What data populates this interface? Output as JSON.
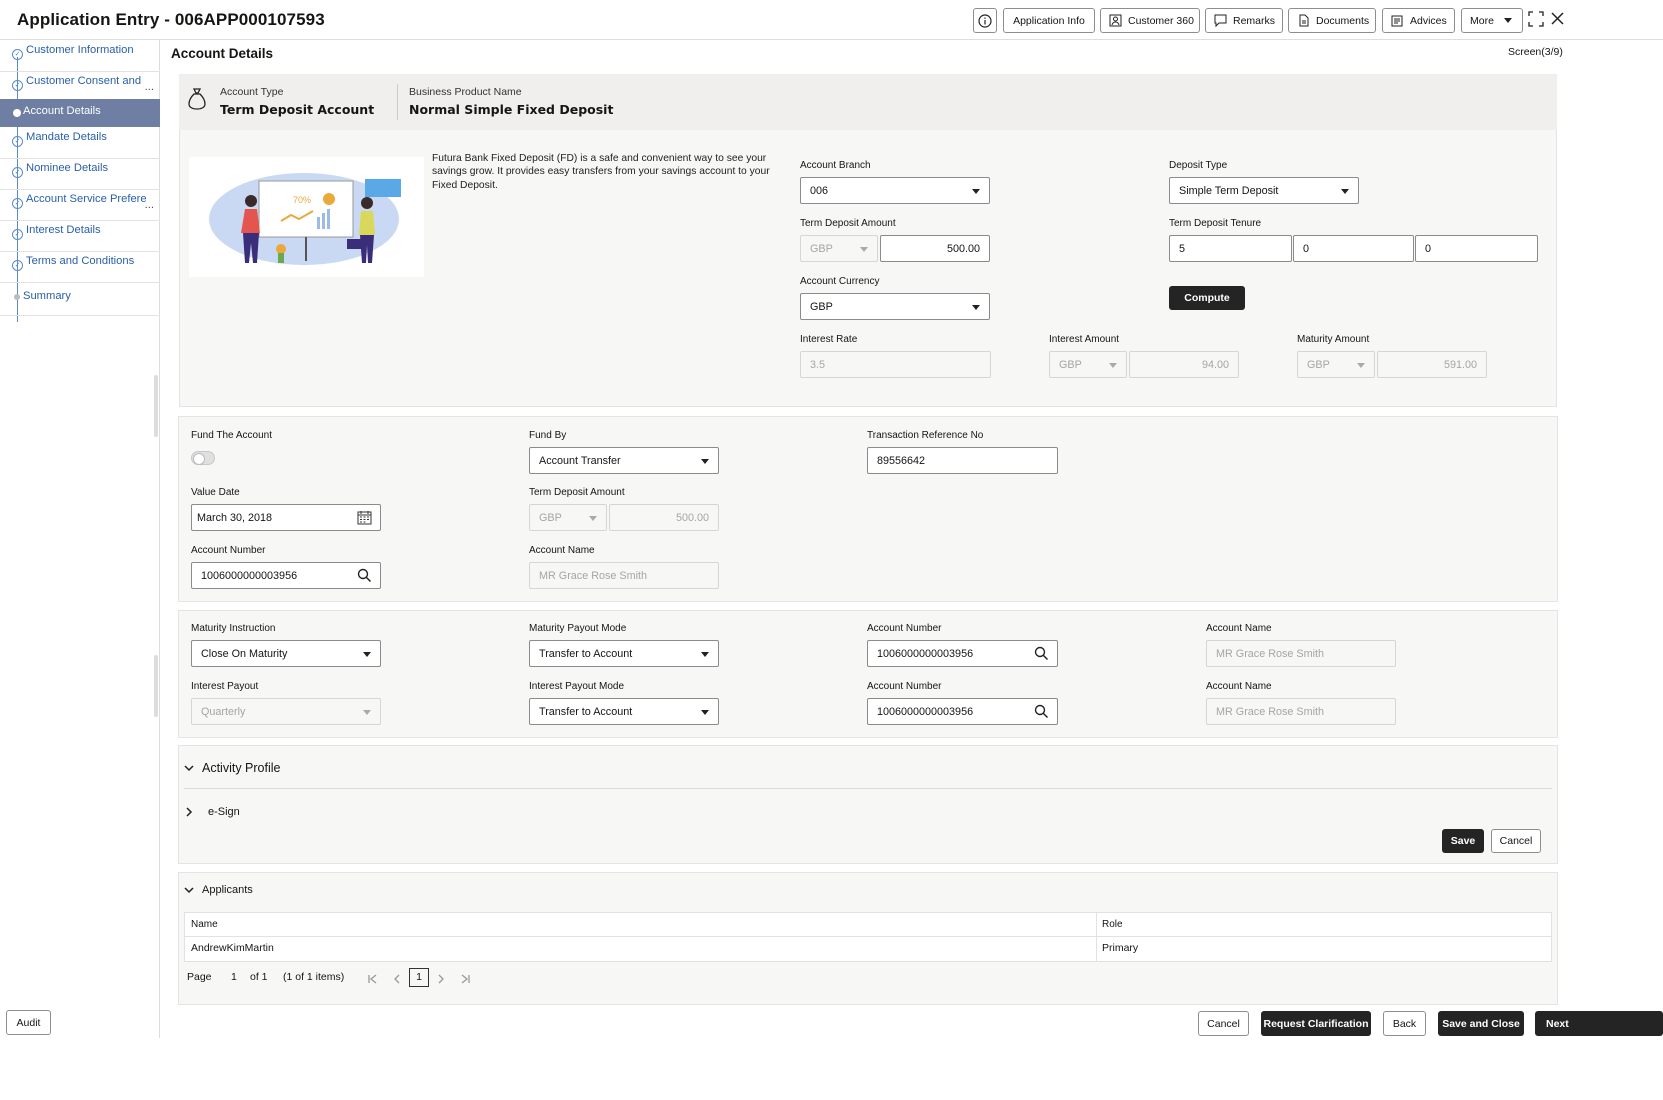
{
  "header": {
    "title": "Application Entry - 006APP000107593",
    "buttons": {
      "info": "i",
      "application_info": "Application Info",
      "customer_360": "Customer 360",
      "remarks": "Remarks",
      "documents": "Documents",
      "advices": "Advices",
      "more": "More"
    }
  },
  "sidebar": {
    "items": [
      {
        "label": "Customer Information",
        "state": "done"
      },
      {
        "label": "Customer Consent and",
        "state": "done",
        "truncated": "..."
      },
      {
        "label": "Account Details",
        "state": "active"
      },
      {
        "label": "Mandate Details",
        "state": "done"
      },
      {
        "label": "Nominee Details",
        "state": "done"
      },
      {
        "label": "Account Service Prefere",
        "state": "done",
        "truncated": "..."
      },
      {
        "label": "Interest Details",
        "state": "done"
      },
      {
        "label": "Terms and Conditions",
        "state": "done"
      },
      {
        "label": "Summary",
        "state": "pending"
      }
    ],
    "audit_label": "Audit"
  },
  "page": {
    "title": "Account Details",
    "screen_indicator": "Screen(3/9)"
  },
  "product": {
    "account_type_label": "Account Type",
    "account_type_value": "Term Deposit Account",
    "business_product_label": "Business Product Name",
    "business_product_value": "Normal Simple Fixed Deposit",
    "description": "Futura Bank Fixed Deposit (FD) is a safe and convenient way to see your savings grow. It provides easy transfers from your savings account to your Fixed Deposit.",
    "illustration_text": "70%"
  },
  "deposit": {
    "account_branch_label": "Account Branch",
    "account_branch_value": "006",
    "deposit_type_label": "Deposit Type",
    "deposit_type_value": "Simple Term Deposit",
    "term_deposit_amount_label": "Term Deposit Amount",
    "term_deposit_currency": "GBP",
    "term_deposit_amount_value": "500.00",
    "tenure_label": "Term Deposit Tenure",
    "tenure_years": "5",
    "tenure_months": "0",
    "tenure_days": "0",
    "account_currency_label": "Account Currency",
    "account_currency_value": "GBP",
    "compute_label": "Compute",
    "interest_rate_label": "Interest Rate",
    "interest_rate_value": "3.5",
    "interest_amount_label": "Interest Amount",
    "interest_amount_currency": "GBP",
    "interest_amount_value": "94.00",
    "maturity_amount_label": "Maturity Amount",
    "maturity_amount_currency": "GBP",
    "maturity_amount_value": "591.00"
  },
  "funding": {
    "fund_account_label": "Fund The Account",
    "fund_account_on": false,
    "fund_by_label": "Fund By",
    "fund_by_value": "Account Transfer",
    "txn_ref_label": "Transaction Reference No",
    "txn_ref_value": "89556642",
    "value_date_label": "Value Date",
    "value_date_value": "March 30, 2018",
    "term_deposit_amount_label": "Term Deposit Amount",
    "term_deposit_currency": "GBP",
    "term_deposit_amount_value": "500.00",
    "account_number_label": "Account Number",
    "account_number_value": "1006000000003956",
    "account_name_label": "Account Name",
    "account_name_value": "MR Grace Rose Smith"
  },
  "maturity": {
    "instruction_label": "Maturity Instruction",
    "instruction_value": "Close On Maturity",
    "payout_mode_label": "Maturity Payout Mode",
    "payout_mode_value": "Transfer to Account",
    "account_number_label": "Account Number",
    "account_number_value": "1006000000003956",
    "account_name_label": "Account Name",
    "account_name_value": "MR Grace Rose Smith",
    "interest_payout_label": "Interest Payout",
    "interest_payout_value": "Quarterly",
    "interest_payout_mode_label": "Interest Payout Mode",
    "interest_payout_mode_value": "Transfer to Account",
    "interest_account_number_label": "Account Number",
    "interest_account_number_value": "1006000000003956",
    "interest_account_name_label": "Account Name",
    "interest_account_name_value": "MR Grace Rose Smith"
  },
  "activity": {
    "title": "Activity Profile",
    "esign_label": "e-Sign",
    "save_label": "Save",
    "cancel_label": "Cancel"
  },
  "applicants": {
    "title": "Applicants",
    "columns": [
      "Name",
      "Role"
    ],
    "rows": [
      {
        "name": "AndrewKimMartin",
        "role": "Primary"
      }
    ],
    "pager": {
      "page_label": "Page",
      "current": "1",
      "of_label": "of 1",
      "items_label": "(1 of 1 items)",
      "page_box": "1"
    }
  },
  "footer": {
    "cancel": "Cancel",
    "request_clarification": "Request Clarification",
    "back": "Back",
    "save_and_close": "Save and Close",
    "next": "Next"
  }
}
